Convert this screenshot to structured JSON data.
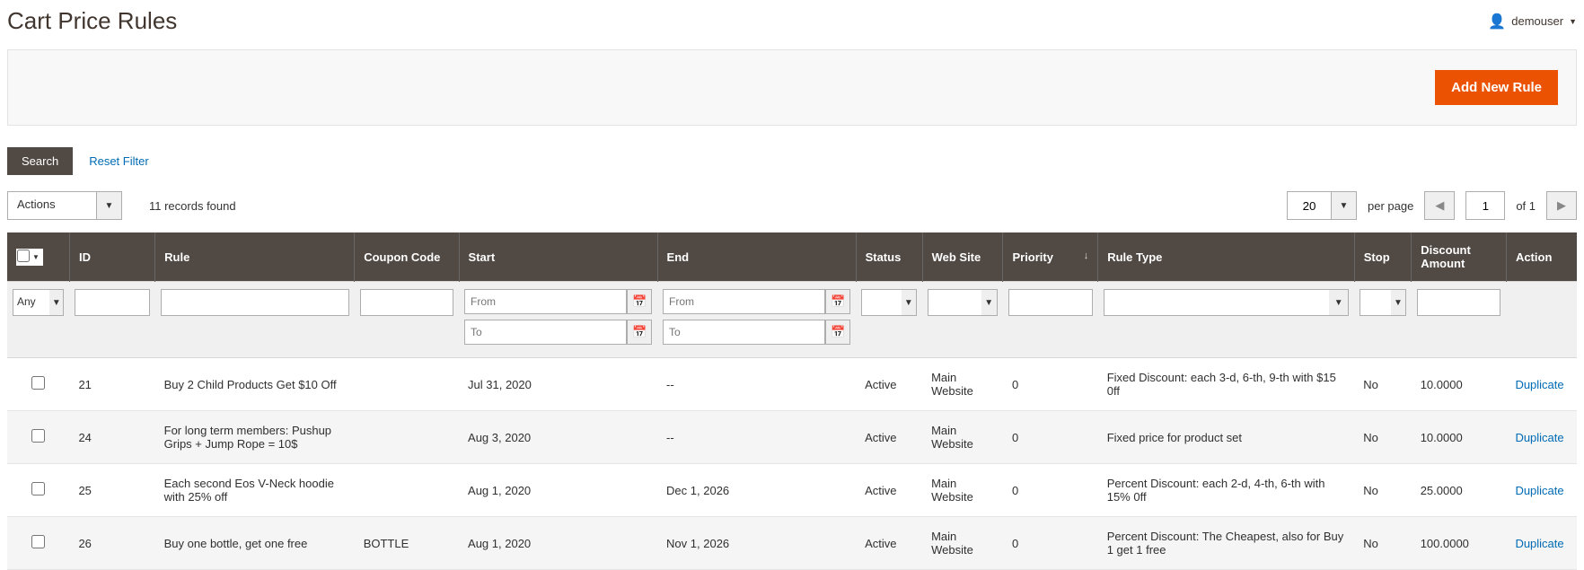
{
  "header": {
    "title": "Cart Price Rules",
    "username": "demouser"
  },
  "buttons": {
    "add_new": "Add New Rule",
    "search": "Search",
    "reset": "Reset Filter",
    "actions": "Actions"
  },
  "grid": {
    "records_found": "11 records found",
    "per_page_value": "20",
    "per_page_label": "per page",
    "page_current": "1",
    "page_total": "of 1"
  },
  "columns": {
    "id": "ID",
    "rule": "Rule",
    "coupon": "Coupon Code",
    "start": "Start",
    "end": "End",
    "status": "Status",
    "website": "Web Site",
    "priority": "Priority",
    "ruletype": "Rule Type",
    "stop": "Stop",
    "discount": "Discount Amount",
    "action": "Action"
  },
  "filters": {
    "any": "Any",
    "from": "From",
    "to": "To"
  },
  "rows": [
    {
      "id": "21",
      "rule": "Buy 2 Child Products Get $10 Off",
      "coupon": "",
      "start": "Jul 31, 2020",
      "end": "--",
      "status": "Active",
      "website": "Main Website",
      "priority": "0",
      "ruletype": "Fixed Discount: each 3-d, 6-th, 9-th with $15 0ff",
      "stop": "No",
      "discount": "10.0000",
      "action": "Duplicate"
    },
    {
      "id": "24",
      "rule": "For long term members: Pushup Grips + Jump Rope = 10$",
      "coupon": "",
      "start": "Aug 3, 2020",
      "end": "--",
      "status": "Active",
      "website": "Main Website",
      "priority": "0",
      "ruletype": "Fixed price for product set",
      "stop": "No",
      "discount": "10.0000",
      "action": "Duplicate"
    },
    {
      "id": "25",
      "rule": "Each second Eos V-Neck hoodie with 25% off",
      "coupon": "",
      "start": "Aug 1, 2020",
      "end": "Dec 1, 2026",
      "status": "Active",
      "website": "Main Website",
      "priority": "0",
      "ruletype": "Percent Discount: each 2-d, 4-th, 6-th with 15% 0ff",
      "stop": "No",
      "discount": "25.0000",
      "action": "Duplicate"
    },
    {
      "id": "26",
      "rule": "Buy one bottle, get one free",
      "coupon": "BOTTLE",
      "start": "Aug 1, 2020",
      "end": "Nov 1, 2026",
      "status": "Active",
      "website": "Main Website",
      "priority": "0",
      "ruletype": "Percent Discount: The Cheapest, also for Buy 1 get 1 free",
      "stop": "No",
      "discount": "100.0000",
      "action": "Duplicate"
    }
  ]
}
